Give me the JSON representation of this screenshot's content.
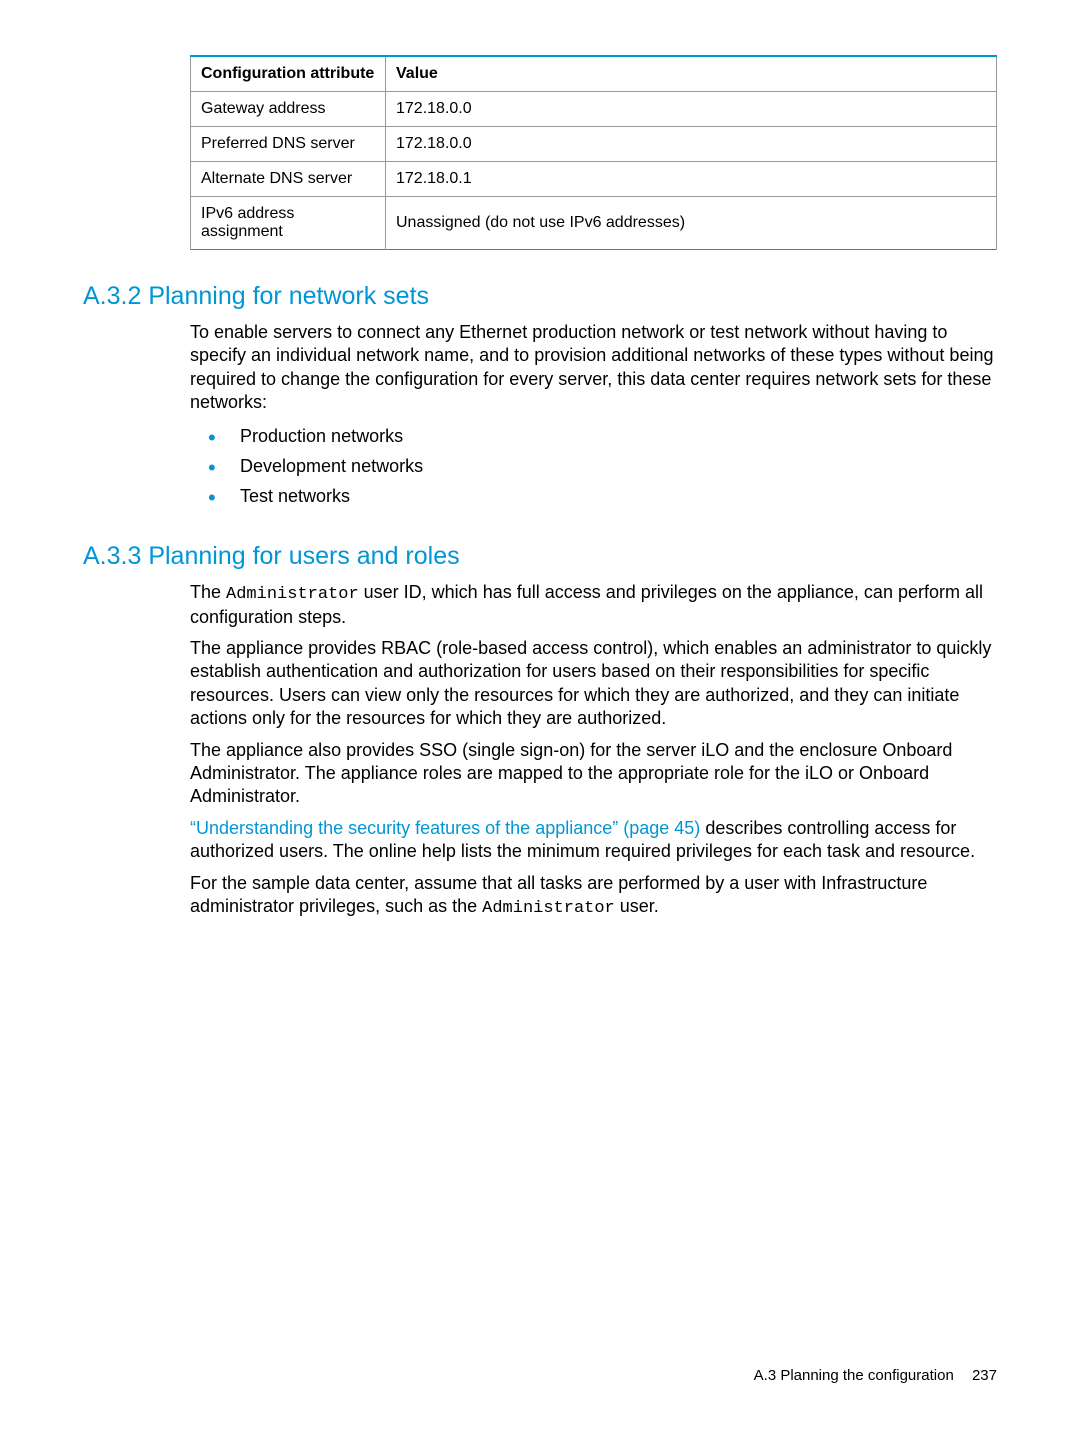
{
  "table": {
    "headers": [
      "Configuration attribute",
      "Value"
    ],
    "rows": [
      [
        "Gateway address",
        "172.18.0.0"
      ],
      [
        "Preferred DNS server",
        "172.18.0.0"
      ],
      [
        "Alternate DNS server",
        "172.18.0.1"
      ],
      [
        "IPv6 address assignment",
        "Unassigned (do not use IPv6 addresses)"
      ]
    ]
  },
  "section_a32": {
    "heading": "A.3.2 Planning for network sets",
    "intro": "To enable servers to connect any Ethernet production network or test network without having to specify an individual network name, and to provision additional networks of these types without being required to change the configuration for every server, this data center requires network sets for these networks:",
    "bullets": [
      "Production networks",
      "Development networks",
      "Test networks"
    ]
  },
  "section_a33": {
    "heading": "A.3.3 Planning for users and roles",
    "p1_pre": "The ",
    "p1_mono": "Administrator",
    "p1_post": " user ID, which has full access and privileges on the appliance, can perform all configuration steps.",
    "p2": "The appliance provides RBAC (role-based access control), which enables an administrator to quickly establish authentication and authorization for users based on their responsibilities for specific resources. Users can view only the resources for which they are authorized, and they can initiate actions only for the resources for which they are authorized.",
    "p3": "The appliance also provides SSO (single sign-on) for the server iLO and the enclosure Onboard Administrator. The appliance roles are mapped to the appropriate role for the iLO or Onboard Administrator.",
    "p4_link": "“Understanding the security features of the appliance” (page 45)",
    "p4_post": " describes controlling access for authorized users. The online help lists the minimum required privileges for each task and resource.",
    "p5_pre": "For the sample data center, assume that all tasks are performed by a user with Infrastructure administrator privileges, such as the ",
    "p5_mono": "Administrator",
    "p5_post": " user."
  },
  "footer": {
    "text": "A.3 Planning the configuration",
    "page": "237"
  }
}
